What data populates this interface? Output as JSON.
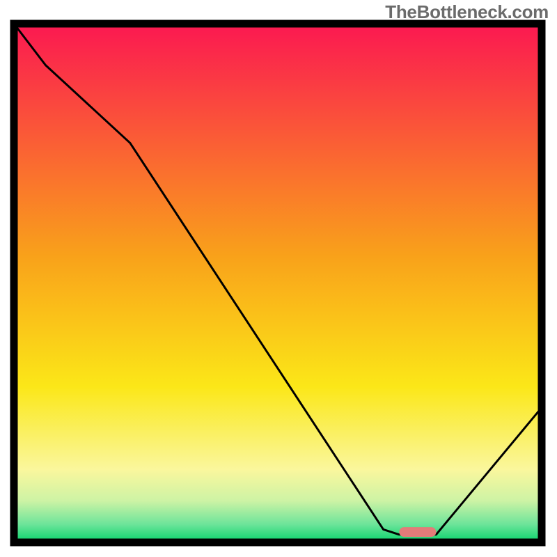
{
  "watermark": "TheBottleneck.com",
  "chart_data": {
    "type": "line",
    "title": "",
    "xlabel": "",
    "ylabel": "",
    "xlim": [
      0,
      1
    ],
    "ylim": [
      0,
      1
    ],
    "grid": false,
    "legend": false,
    "series": [
      {
        "name": "bottleneck_curve",
        "x": [
          0.0,
          0.06,
          0.22,
          0.7,
          0.73,
          0.8,
          1.0
        ],
        "y": [
          1.0,
          0.92,
          0.77,
          0.025,
          0.015,
          0.015,
          0.26
        ],
        "annotations": []
      }
    ],
    "marker": {
      "name": "optimal_range",
      "x0": 0.73,
      "x1": 0.8,
      "y": 0.02,
      "color": "#e37b79"
    },
    "background_gradient": {
      "stops": [
        {
          "pos": 0.0,
          "color": "#fb1851"
        },
        {
          "pos": 0.45,
          "color": "#f9a21a"
        },
        {
          "pos": 0.7,
          "color": "#fbe718"
        },
        {
          "pos": 0.86,
          "color": "#faf79d"
        },
        {
          "pos": 0.92,
          "color": "#cdf3a5"
        },
        {
          "pos": 0.965,
          "color": "#6de49a"
        },
        {
          "pos": 1.0,
          "color": "#07d36b"
        }
      ]
    },
    "border_color": "#000000"
  }
}
